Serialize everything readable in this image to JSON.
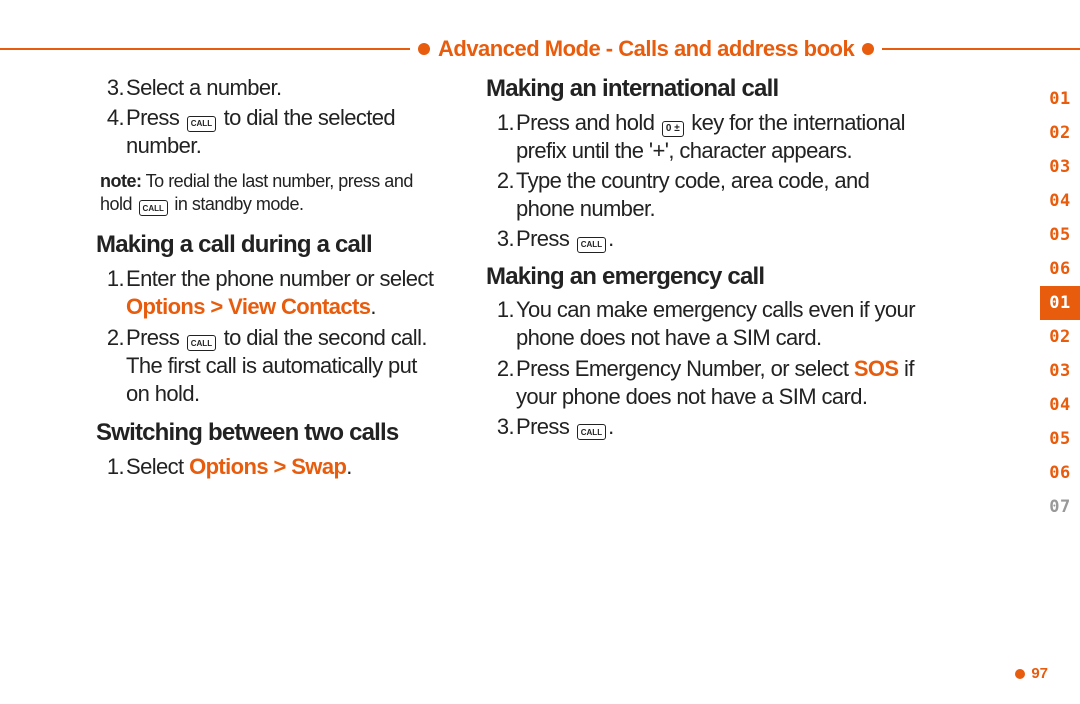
{
  "header": {
    "title": "Advanced Mode - Calls and address book"
  },
  "left": {
    "item3": {
      "num": "3.",
      "text": "Select a number."
    },
    "item4": {
      "num": "4.",
      "pre": "Press ",
      "icon": "CALL",
      "post": " to dial the selected number."
    },
    "note": {
      "label": "note:",
      "pre": " To redial the last number, press and hold ",
      "icon": "CALL",
      "post": " in standby mode."
    },
    "sec1": {
      "heading": "Making a call during a call",
      "i1": {
        "num": "1.",
        "pre": "Enter the phone number or select ",
        "link": "Options > View Contacts",
        "post": "."
      },
      "i2": {
        "num": "2.",
        "pre": "Press ",
        "icon": "CALL",
        "post": " to dial the second call. The first call is automatically put on hold."
      }
    },
    "sec2": {
      "heading": "Switching between two calls",
      "i1": {
        "num": "1.",
        "pre": "Select ",
        "link": "Options > Swap",
        "post": "."
      }
    }
  },
  "right": {
    "sec1": {
      "heading": "Making an international call",
      "i1": {
        "num": "1.",
        "pre": "Press and hold ",
        "icon": "0 ±",
        "post": " key for the international prefix until the '+', character appears."
      },
      "i2": {
        "num": "2.",
        "text": "Type the country code, area code, and phone number."
      },
      "i3": {
        "num": "3.",
        "pre": "Press ",
        "icon": "CALL",
        "post": "."
      }
    },
    "sec2": {
      "heading": "Making an emergency call",
      "i1": {
        "num": "1.",
        "text": "You can make emergency calls even if your phone does not have a SIM card."
      },
      "i2": {
        "num": "2.",
        "pre": "Press Emergency Number, or select ",
        "link": "SOS",
        "post": " if your phone does not have a SIM card."
      },
      "i3": {
        "num": "3.",
        "pre": "Press ",
        "icon": "CALL",
        "post": "."
      }
    }
  },
  "tabs": {
    "groupA": [
      "01",
      "02",
      "03",
      "04",
      "05",
      "06"
    ],
    "groupB": [
      "01",
      "02",
      "03",
      "04",
      "05",
      "06",
      "07"
    ],
    "current": "01"
  },
  "page_number": "97"
}
